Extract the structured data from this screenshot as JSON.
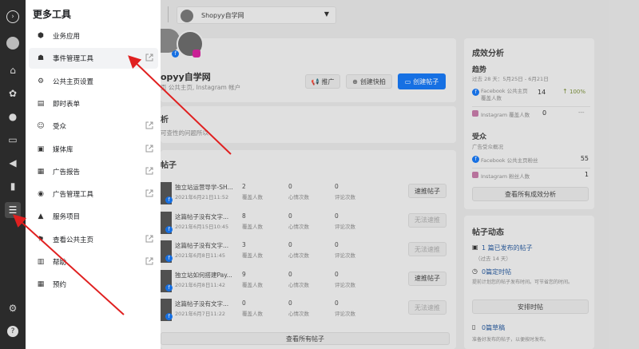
{
  "menu": {
    "title": "更多工具",
    "items": [
      {
        "label": "业务应用",
        "icon": "cube-icon",
        "glyph": "⬢",
        "external": false
      },
      {
        "label": "事件管理工具",
        "icon": "people-network-icon",
        "glyph": "☗",
        "external": true
      },
      {
        "label": "公共主页设置",
        "icon": "gear-icon",
        "glyph": "⚙",
        "external": false
      },
      {
        "label": "即时表单",
        "icon": "form-icon",
        "glyph": "▤",
        "external": false
      },
      {
        "label": "受众",
        "icon": "audience-icon",
        "glyph": "☺",
        "external": true
      },
      {
        "label": "媒体库",
        "icon": "image-icon",
        "glyph": "▣",
        "external": true
      },
      {
        "label": "广告报告",
        "icon": "report-icon",
        "glyph": "▦",
        "external": true
      },
      {
        "label": "广告管理工具",
        "icon": "ads-manager-icon",
        "glyph": "◉",
        "external": true
      },
      {
        "label": "服务项目",
        "icon": "service-bell-icon",
        "glyph": "▲",
        "external": false
      },
      {
        "label": "查看公共主页",
        "icon": "flag-icon",
        "glyph": "⚑",
        "external": true
      },
      {
        "label": "帮助",
        "icon": "help-book-icon",
        "glyph": "▥",
        "external": true
      },
      {
        "label": "预约",
        "icon": "calendar-icon",
        "glyph": "▦",
        "external": false
      }
    ]
  },
  "topbar": {
    "page_name": "Shopyy自学网"
  },
  "profile": {
    "name": "opyy自学网",
    "sub": "页 公共主页, Instagram 帐户",
    "buttons": {
      "ad": "推广",
      "reel": "创建快拍",
      "post": "创建帖子"
    }
  },
  "notify": {
    "title": "析",
    "sub": "可查性的问题所以"
  },
  "posts": {
    "title": "帖子",
    "rows": [
      {
        "title": "独立站运营导学-SH...",
        "date": "2021年6月21日11:52",
        "reach": "2",
        "reach_label": "覆盖人数",
        "eng": "0",
        "eng_label": "心情次数",
        "com": "0",
        "com_label": "评论次数",
        "btn": "速推帖子"
      },
      {
        "title": "这篇帖子没有文字...",
        "date": "2021年6月15日10:45",
        "reach": "8",
        "reach_label": "覆盖人数",
        "eng": "0",
        "eng_label": "心情次数",
        "com": "0",
        "com_label": "评论次数",
        "btn": "无法速推"
      },
      {
        "title": "这篇帖子没有文字...",
        "date": "2021年6月8日11:45",
        "reach": "3",
        "reach_label": "覆盖人数",
        "eng": "0",
        "eng_label": "心情次数",
        "com": "0",
        "com_label": "评论次数",
        "btn": "无法速推"
      },
      {
        "title": "独立站如何搭建Pay...",
        "date": "2021年6月8日11:42",
        "reach": "9",
        "reach_label": "覆盖人数",
        "eng": "0",
        "eng_label": "心情次数",
        "com": "0",
        "com_label": "评论次数",
        "btn": "速推帖子"
      },
      {
        "title": "这篇帖子没有文字...",
        "date": "2021年6月7日11:22",
        "reach": "0",
        "reach_label": "覆盖人数",
        "eng": "0",
        "eng_label": "心情次数",
        "com": "0",
        "com_label": "评论次数",
        "btn": "无法速推"
      }
    ],
    "view_all": "查看所有帖子"
  },
  "analysis": {
    "title": "成效分析",
    "trend_title": "趋势",
    "trend_range": "过去 28 天：5月25日 - 6月21日",
    "trend_rows": [
      {
        "label": "Facebook 公共主页覆盖人数",
        "value": "14",
        "delta": "100%"
      },
      {
        "label": "Instagram 覆盖人数",
        "value": "0",
        "delta": "---"
      }
    ],
    "aud_title": "受众",
    "aud_sub": "广告受众概况",
    "aud_rows": [
      {
        "label": "Facebook 公共主页粉丝",
        "value": "55"
      },
      {
        "label": "Instagram 粉丝人数",
        "value": "1"
      }
    ],
    "button": "查看所有成效分析"
  },
  "activity": {
    "title": "帖子动态",
    "scheduled": "1 篇已发布的帖子",
    "scheduled_sub": "（过去 14 天）",
    "drafts": "0篇定时帖",
    "drafts_sub": "提前计划您的帖子发布时间。可节省您的时间。",
    "drafts_btn": "安排时帖",
    "more": "0篇草稿",
    "more_sub": "准备好发布的帖子，以便按时发布。"
  }
}
